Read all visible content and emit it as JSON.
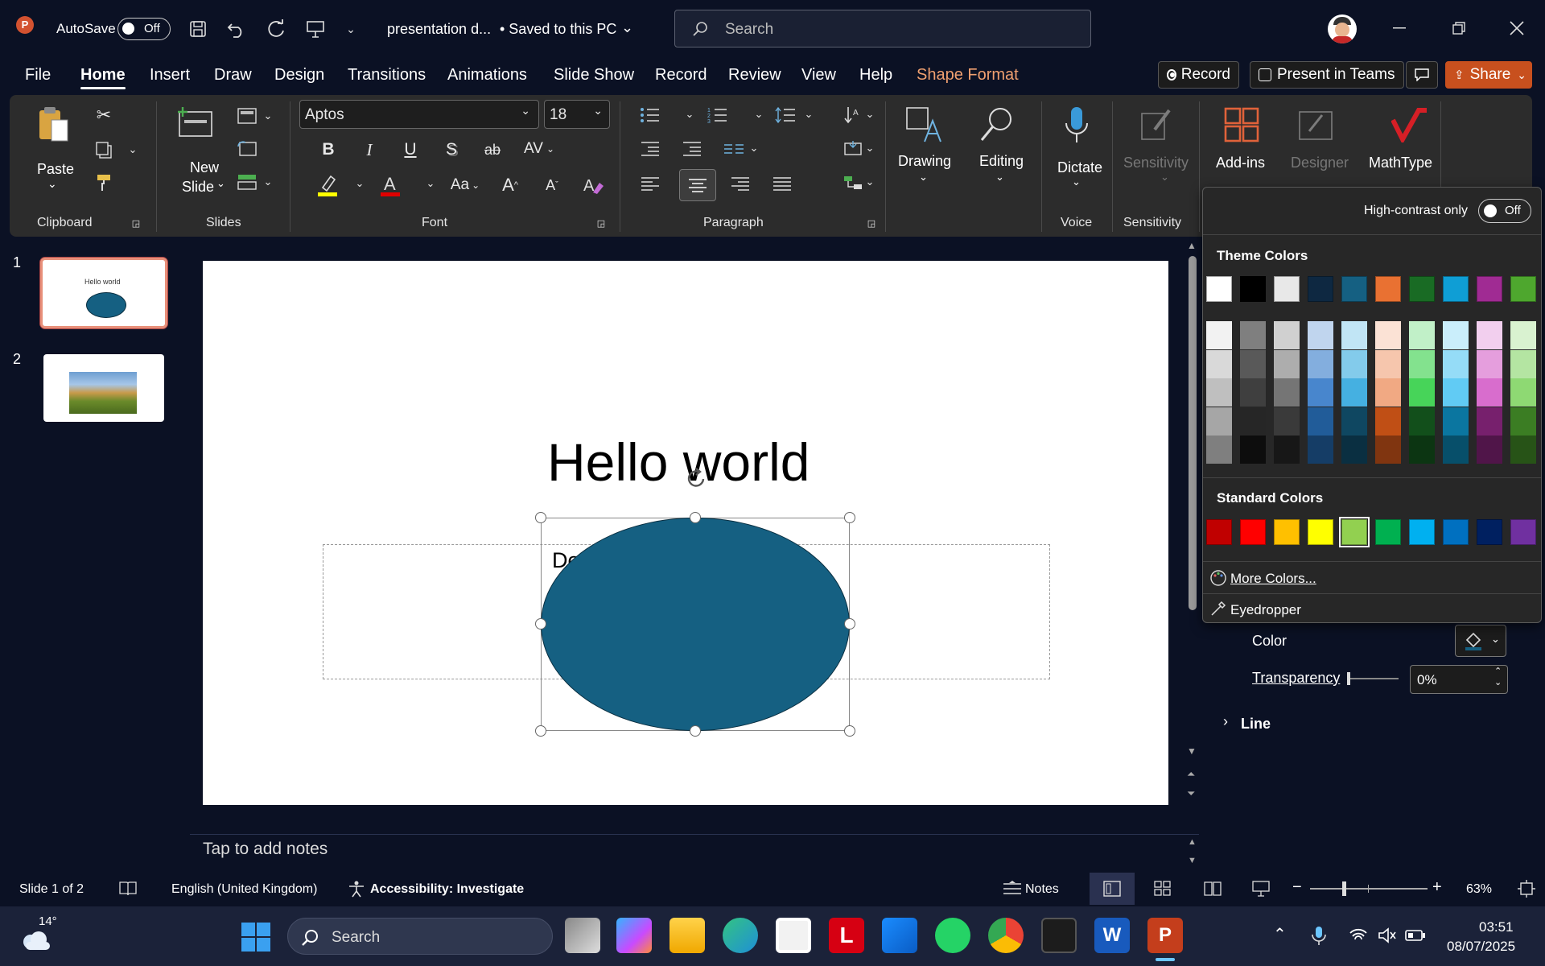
{
  "titlebar": {
    "autosave_label": "AutoSave",
    "autosave_state": "Off",
    "doc_title": "presentation d...",
    "saved_status": "• Saved to this PC",
    "search_placeholder": "Search"
  },
  "tabs": [
    "File",
    "Home",
    "Insert",
    "Draw",
    "Design",
    "Transitions",
    "Animations",
    "Slide Show",
    "Record",
    "Review",
    "View",
    "Help",
    "Shape Format"
  ],
  "actions": {
    "record": "Record",
    "present_teams": "Present in Teams",
    "share": "Share"
  },
  "ribbon": {
    "paste": "Paste",
    "new_slide_1": "New",
    "new_slide_2": "Slide",
    "font_name": "Aptos",
    "font_size": "18",
    "drawing": "Drawing",
    "editing": "Editing",
    "dictate": "Dictate",
    "sensitivity_btn": "Sensitivity",
    "addins": "Add-ins",
    "designer": "Designer",
    "mathtype": "MathType",
    "groups": {
      "clipboard": "Clipboard",
      "slides": "Slides",
      "font": "Font",
      "paragraph": "Paragraph",
      "voice": "Voice",
      "sensitivity": "Sensitivity"
    }
  },
  "thumbnails": [
    {
      "number": "1",
      "caption": "Hello world"
    },
    {
      "number": "2"
    }
  ],
  "slide": {
    "title": "Hello world",
    "body_partial": "Do"
  },
  "notes_placeholder": "Tap to add notes",
  "color_popup": {
    "high_contrast_label": "High-contrast only",
    "high_contrast_state": "Off",
    "theme_title": "Theme Colors",
    "standard_title": "Standard Colors",
    "more_colors": "More Colors...",
    "eyedropper": "Eyedropper",
    "theme_base": [
      "#ffffff",
      "#000000",
      "#e8e8e8",
      "#0e2841",
      "#156082",
      "#e97132",
      "#196b24",
      "#0f9ed5",
      "#a02b93",
      "#4ea72e"
    ],
    "theme_shades": [
      [
        "#f2f2f2",
        "#d9d9d9",
        "#bfbfbf",
        "#a6a6a6",
        "#7f7f7f"
      ],
      [
        "#7f7f7f",
        "#595959",
        "#3f3f3f",
        "#262626",
        "#0d0d0d"
      ],
      [
        "#d0d0d0",
        "#adadad",
        "#757575",
        "#3a3a3a",
        "#171717"
      ],
      [
        "#c0d5ee",
        "#83aede",
        "#4886cd",
        "#215c99",
        "#153d66"
      ],
      [
        "#c1e5f5",
        "#83cbeb",
        "#45b0e1",
        "#0f4761",
        "#0a2f41"
      ],
      [
        "#fbe2d5",
        "#f6c6ad",
        "#f1a983",
        "#c04f15",
        "#803510"
      ],
      [
        "#c1f0c8",
        "#83e28e",
        "#47d459",
        "#124f1b",
        "#0c3512"
      ],
      [
        "#caeefb",
        "#95dcf7",
        "#61cbf4",
        "#0b76a0",
        "#074f6a"
      ],
      [
        "#f2cfee",
        "#e59edd",
        "#d86dcd",
        "#77206d",
        "#501549"
      ],
      [
        "#d9f2d0",
        "#b4e5a2",
        "#8ed973",
        "#3b7d23",
        "#275317"
      ]
    ],
    "standard": [
      "#c00000",
      "#ff0000",
      "#ffc000",
      "#ffff00",
      "#92d050",
      "#00b050",
      "#00b0f0",
      "#0070c0",
      "#002060",
      "#7030a0"
    ]
  },
  "format_pane": {
    "color_label": "Color",
    "transparency_label": "Transparency",
    "transparency_value": "0%",
    "line_label": "Line"
  },
  "statusbar": {
    "slide_info": "Slide 1 of 2",
    "language": "English (United Kingdom)",
    "accessibility": "Accessibility: Investigate",
    "notes": "Notes",
    "zoom": "63%"
  },
  "taskbar": {
    "temperature": "14°",
    "search": "Search",
    "time": "03:51",
    "date": "08/07/2025"
  },
  "colors": {
    "accent_tab": "#f0a070",
    "shape_fill": "#156082",
    "share_btn": "#c8501e",
    "thumb_selected": "#e8907a"
  }
}
